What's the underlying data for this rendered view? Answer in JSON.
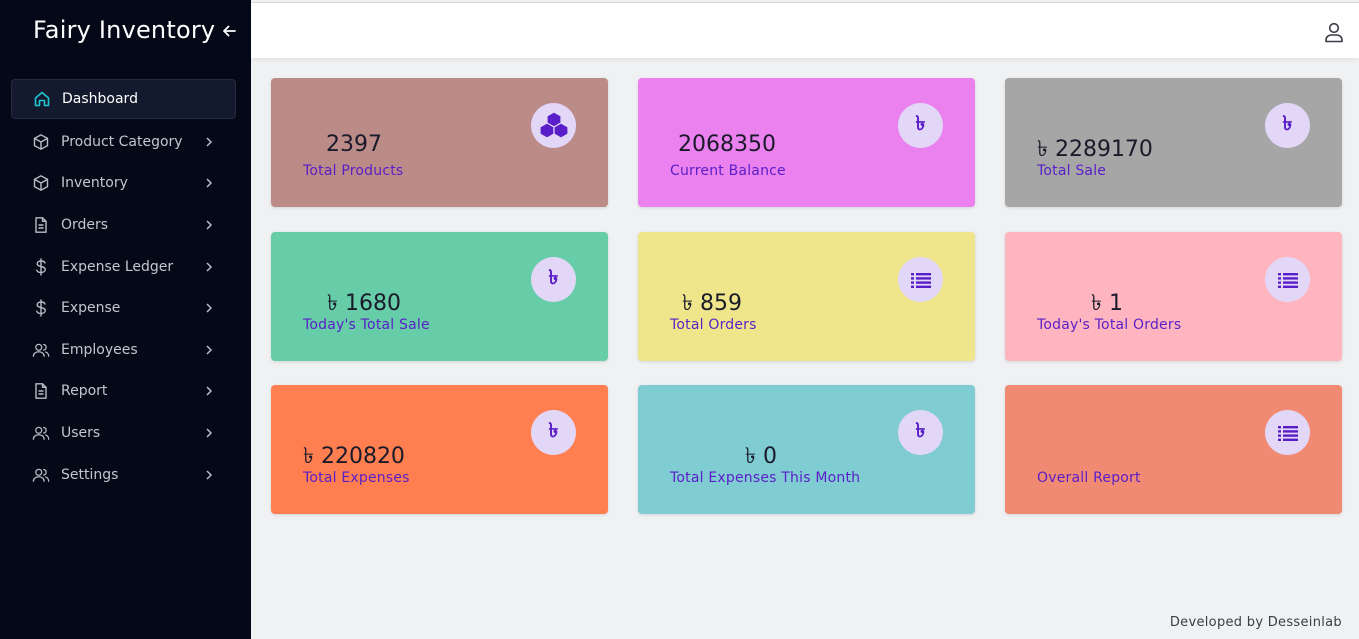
{
  "app": {
    "title": "Fairy Inventory"
  },
  "sidebar": {
    "items": [
      {
        "label": "Dashboard",
        "icon": "home-icon",
        "active": true
      },
      {
        "label": "Product Category",
        "icon": "cube-icon"
      },
      {
        "label": "Inventory",
        "icon": "cube-icon"
      },
      {
        "label": "Orders",
        "icon": "document-icon"
      },
      {
        "label": "Expense Ledger",
        "icon": "dollar-icon"
      },
      {
        "label": "Expense",
        "icon": "dollar-icon"
      },
      {
        "label": "Employees",
        "icon": "users-icon"
      },
      {
        "label": "Report",
        "icon": "document-icon"
      },
      {
        "label": "Users",
        "icon": "users-icon"
      },
      {
        "label": "Settings",
        "icon": "users-icon"
      }
    ]
  },
  "cards": [
    {
      "value": "2397",
      "label": "Total Products",
      "color": "#bb8b88",
      "icon": "cubes-icon"
    },
    {
      "value": "2068350",
      "label": "Current Balance",
      "color": "#ea81ef",
      "icon": "taka-icon"
    },
    {
      "value": "৳ 2289170",
      "label": "Total Sale",
      "color": "#a6a6a6",
      "icon": "taka-icon"
    },
    {
      "value": "৳ 1680",
      "label": "Today's Total Sale",
      "color": "#66cda8",
      "icon": "taka-icon"
    },
    {
      "value": "৳ 859",
      "label": "Total Orders",
      "color": "#efe68b",
      "icon": "list-icon"
    },
    {
      "value": "৳ 1",
      "label": "Today's Total Orders",
      "color": "#ffb5c0",
      "icon": "list-icon"
    },
    {
      "value": "৳ 220820",
      "label": "Total Expenses",
      "color": "#ff7f50",
      "icon": "taka-icon"
    },
    {
      "value": "৳ 0",
      "label": "Total Expenses This Month",
      "color": "#7fcdd3",
      "icon": "taka-icon"
    },
    {
      "value": "",
      "label": "Overall Report",
      "color": "#f08a73",
      "icon": "list-icon"
    }
  ],
  "badge_glyph": "৳",
  "footer": {
    "text": "Developed by Desseinlab"
  }
}
